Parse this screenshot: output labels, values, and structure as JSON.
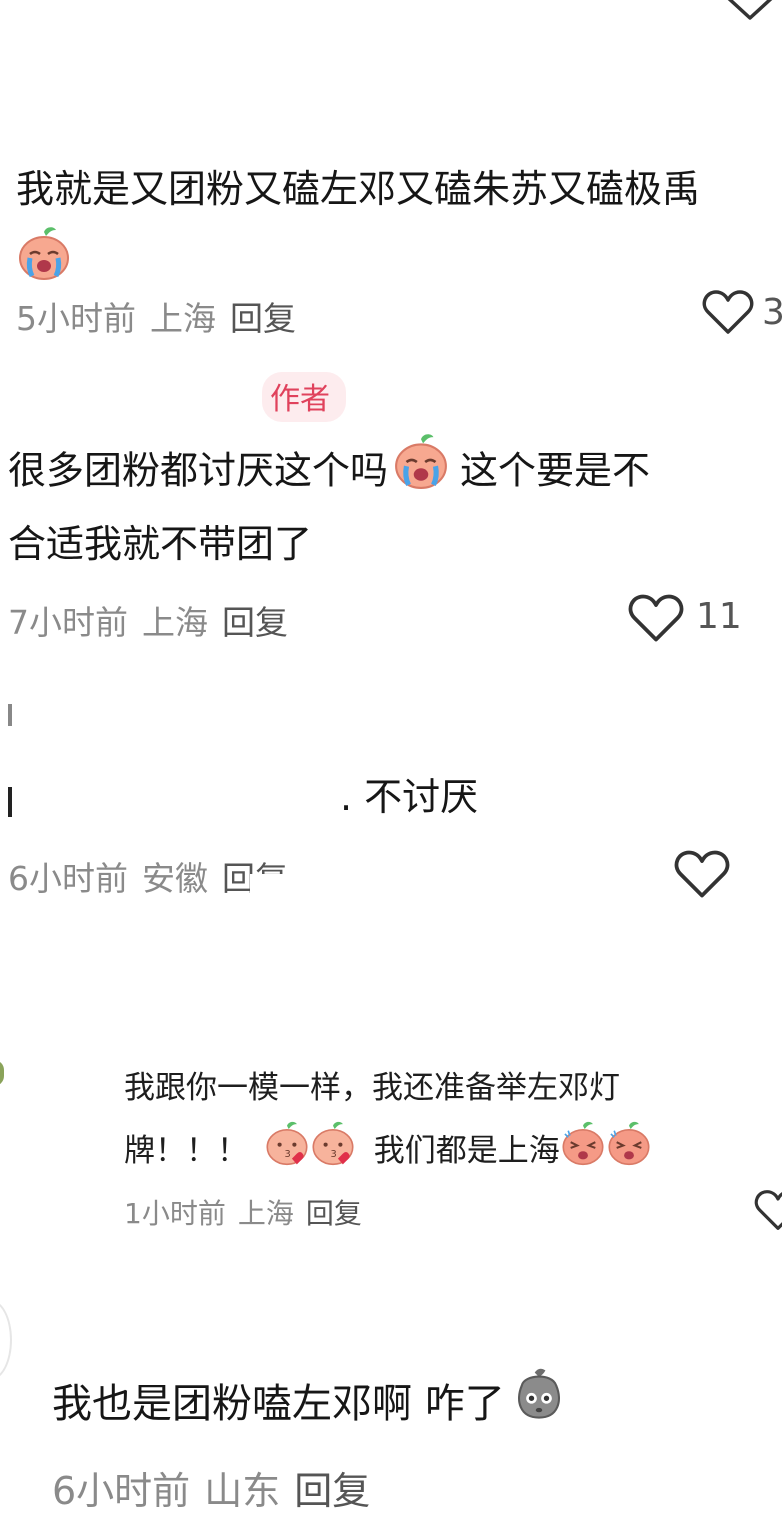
{
  "comments": [
    {
      "text": "我就是又团粉又磕左邓又磕朱苏又磕极禹",
      "time": "5小时前",
      "location": "上海",
      "reply": "回复",
      "likes": "3"
    },
    {
      "badge": "作者",
      "text_line1": "很多团粉都讨厌这个吗",
      "text_line1b": "这个要是不",
      "text_line2": "合适我就不带团了",
      "time": "7小时前",
      "location": "上海",
      "reply": "回复",
      "likes": "11"
    },
    {
      "text": "不讨厌",
      "time": "6小时前",
      "location": "安徽",
      "reply": "回复"
    },
    {
      "text_line1": "我跟你一模一样，我还准备举左邓灯",
      "text_line2a": "牌！！！",
      "text_line2b": "我们都是上海",
      "time": "1小时前",
      "location": "上海",
      "reply": "回复"
    },
    {
      "text": "我也是团粉嗑左邓啊 咋了",
      "time": "6小时前",
      "location": "山东",
      "reply": "回复"
    }
  ],
  "icons": {
    "heart": "heart-outline-icon",
    "chevron": "chevron-down-icon",
    "emoji_cry": "crying-peach-emoji",
    "emoji_kiss": "kissing-peach-emoji",
    "emoji_angry": "angry-peach-emoji",
    "emoji_shy": "gray-blob-emoji"
  },
  "colors": {
    "badge_bg": "#fdecee",
    "badge_text": "#e0425c",
    "meta": "#8a8a8a"
  }
}
